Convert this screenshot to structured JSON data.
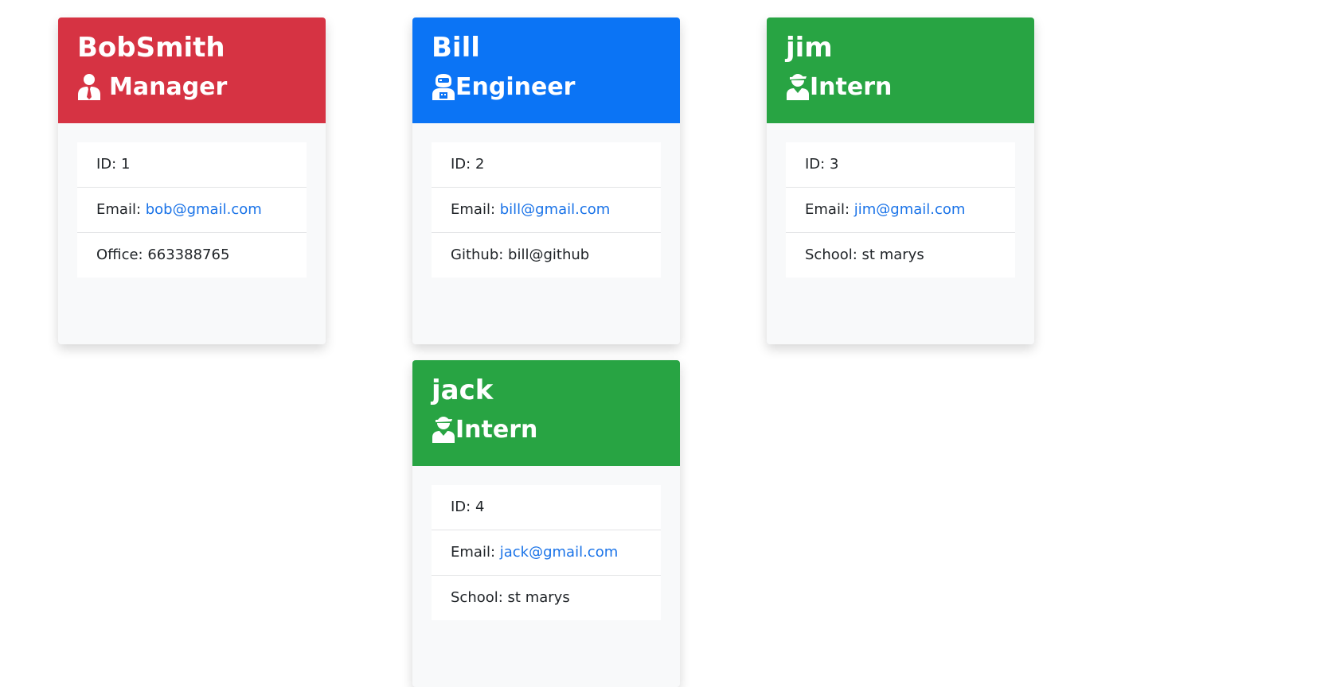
{
  "colors": {
    "manager": "#d63343",
    "engineer": "#0b74f5",
    "intern": "#28a443",
    "link": "#1a73e8",
    "card_body": "#f8f9fa"
  },
  "labels": {
    "id": "ID: ",
    "email": "Email: "
  },
  "cards": [
    {
      "name": "BobSmith",
      "role": "Manager",
      "role_icon": "manager-icon",
      "id": "1",
      "email": "bob@gmail.com",
      "extra_label": "Office: ",
      "extra_value": "663388765"
    },
    {
      "name": "Bill",
      "role": "Engineer",
      "role_icon": "engineer-icon",
      "id": "2",
      "email": "bill@gmail.com",
      "extra_label": "Github: ",
      "extra_value": "bill@github"
    },
    {
      "name": "jim",
      "role": "Intern",
      "role_icon": "intern-icon",
      "id": "3",
      "email": "jim@gmail.com",
      "extra_label": "School: ",
      "extra_value": "st marys"
    },
    {
      "name": "jack",
      "role": "Intern",
      "role_icon": "intern-icon",
      "id": "4",
      "email": "jack@gmail.com",
      "extra_label": "School: ",
      "extra_value": "st marys"
    }
  ]
}
